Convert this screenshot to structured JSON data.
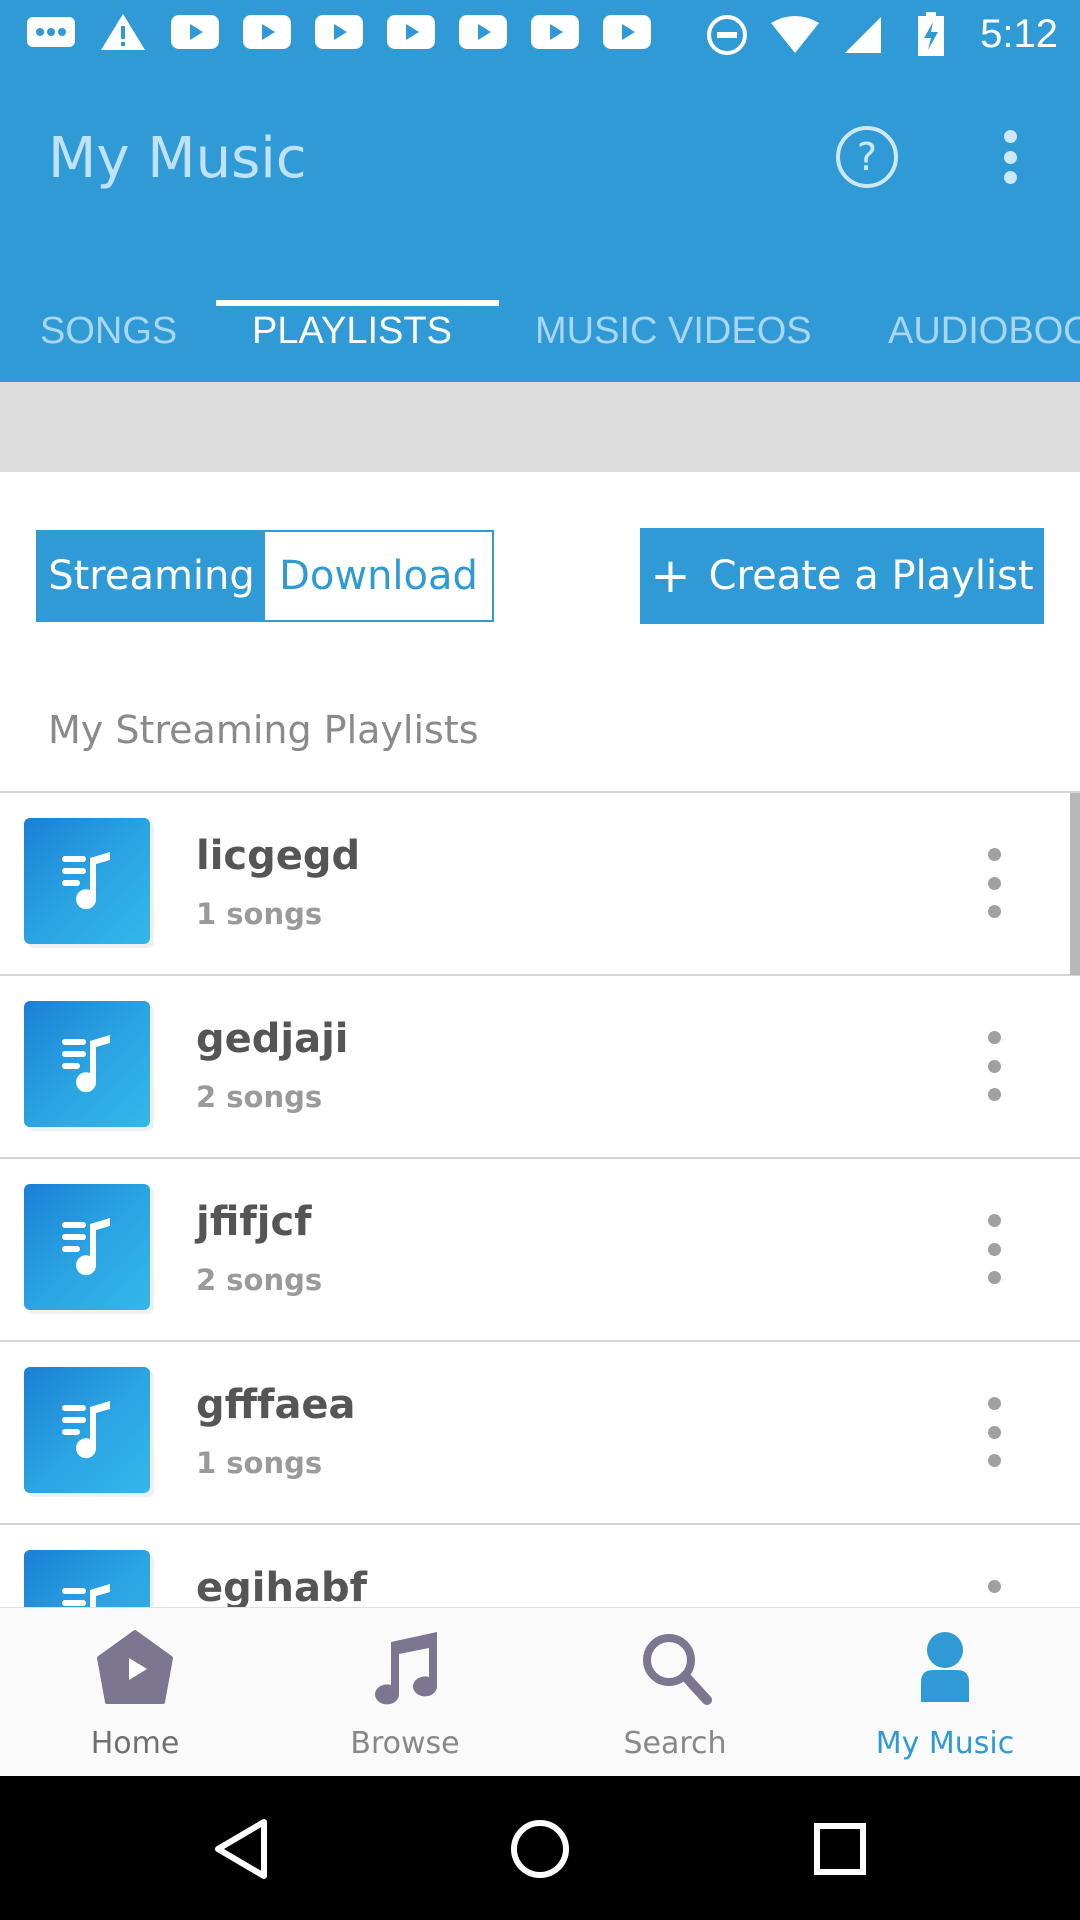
{
  "status_bar": {
    "time": "5:12",
    "left_icons": [
      "message-icon",
      "warning-icon",
      "youtube-icon",
      "youtube-icon",
      "youtube-icon",
      "youtube-icon",
      "youtube-icon",
      "youtube-icon",
      "youtube-icon"
    ],
    "right_icons": [
      "dnd-icon",
      "wifi-icon",
      "signal-icon",
      "battery-charging-icon"
    ]
  },
  "app_bar": {
    "title": "My Music",
    "tabs": [
      {
        "label": "SONGS"
      },
      {
        "label": "PLAYLISTS"
      },
      {
        "label": "MUSIC VIDEOS"
      },
      {
        "label": "AUDIOBOO"
      }
    ],
    "active_tab": "PLAYLISTS"
  },
  "toggle": {
    "streaming_label": "Streaming",
    "download_label": "Download",
    "selected": "Streaming"
  },
  "create_button": {
    "plus": "+",
    "label": "Create a Playlist"
  },
  "section_title": "My Streaming Playlists",
  "playlists": [
    {
      "name": "licgegd",
      "count": "1 songs"
    },
    {
      "name": "gedjaji",
      "count": "2 songs"
    },
    {
      "name": "jfifjcf",
      "count": "2 songs"
    },
    {
      "name": "gfffaea",
      "count": "1 songs"
    },
    {
      "name": "egihabf",
      "count": ""
    }
  ],
  "bottom_nav": {
    "items": [
      {
        "label": "Home",
        "icon": "home-icon"
      },
      {
        "label": "Browse",
        "icon": "music-note-icon"
      },
      {
        "label": "Search",
        "icon": "search-icon"
      },
      {
        "label": "My Music",
        "icon": "person-icon"
      }
    ],
    "active": "My Music"
  },
  "colors": {
    "primary": "#2f9ad6",
    "tab_inactive": "#a9d7f3",
    "nav_inactive": "#888888",
    "nav_icon": "#7d7690"
  }
}
